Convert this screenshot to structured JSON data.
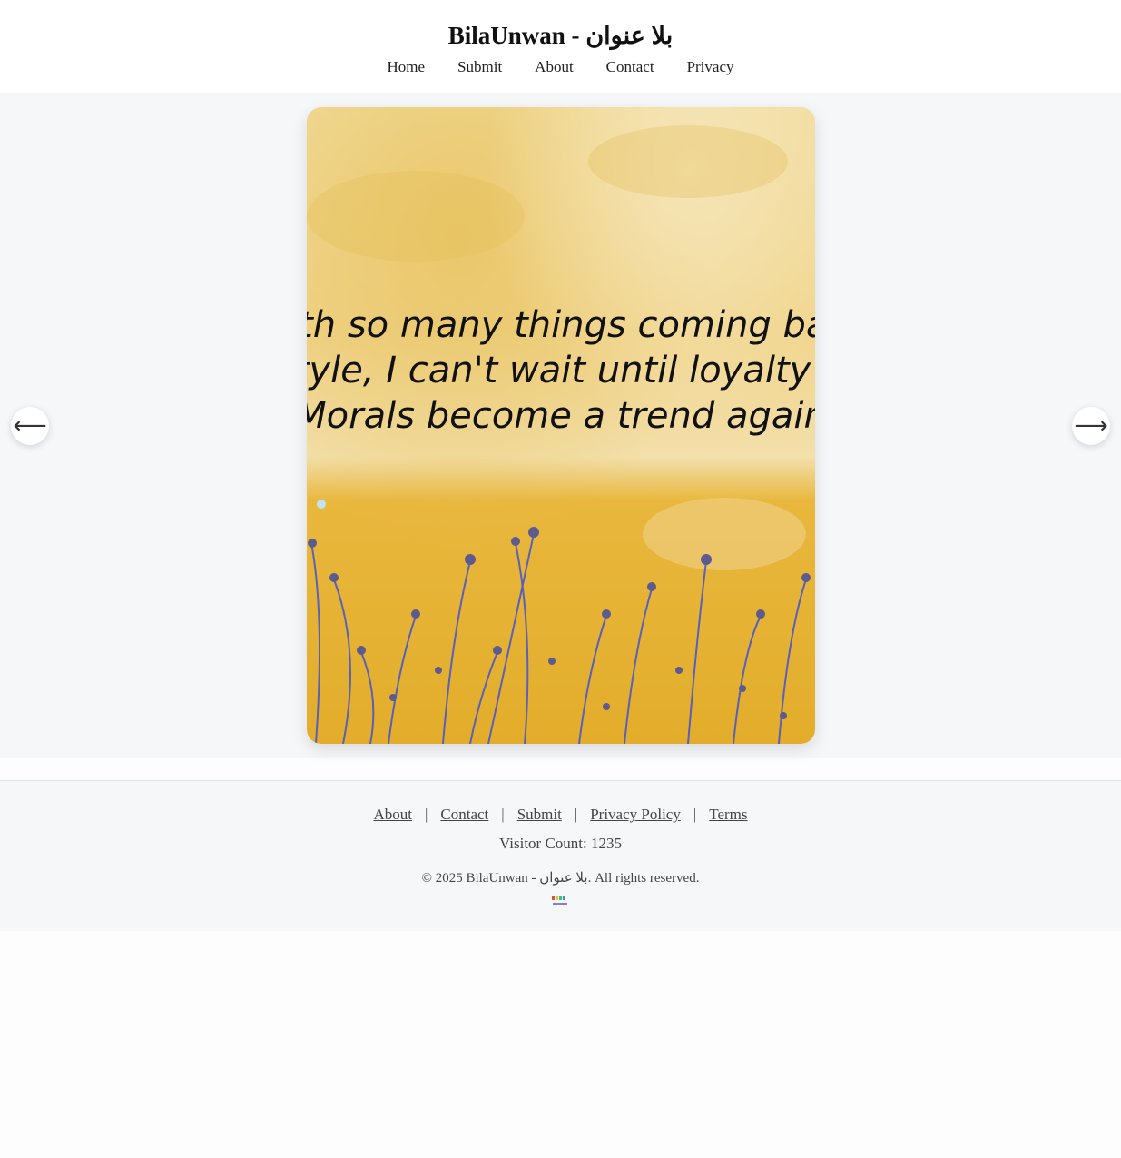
{
  "header": {
    "title": "BilaUnwan - بلا عنوان",
    "nav": [
      "Home",
      "Submit",
      "About",
      "Contact",
      "Privacy"
    ]
  },
  "carousel": {
    "quote_lines": [
      "With so many things coming back",
      "in style, I can't wait until loyalty and",
      "Morals become a trend again"
    ],
    "prev_icon": "arrow-left-icon",
    "next_icon": "arrow-right-icon"
  },
  "footer": {
    "links": [
      "About",
      "Contact",
      "Submit",
      "Privacy Policy",
      "Terms"
    ],
    "separator": "|",
    "visitor_count": "Visitor Count: 1235",
    "copyright": "© 2025 BilaUnwan - بلا عنوان. All rights reserved."
  },
  "colors": {
    "wall": "#e9b73a",
    "wall_light": "#f3dfa6",
    "flowers": "#6a6fb0",
    "stems": "#4a58c8"
  }
}
